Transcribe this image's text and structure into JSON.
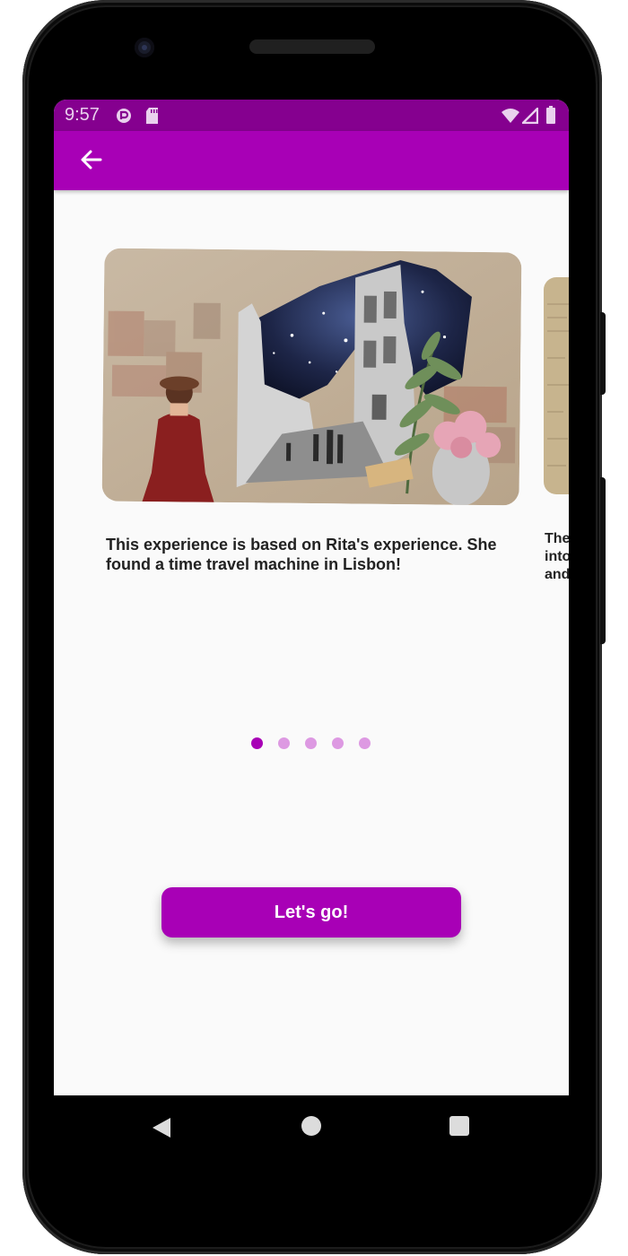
{
  "status_bar": {
    "time": "9:57",
    "icons": [
      "app-notification-icon",
      "sd-card-icon",
      "wifi-icon",
      "signal-icon",
      "battery-icon"
    ]
  },
  "app_bar": {
    "back_icon": "arrow-left-icon"
  },
  "carousel": {
    "slides": [
      {
        "caption": "This experience is based on Rita's experience. She found a time travel machine in Lisbon!"
      },
      {
        "caption": "The\ninto\nand"
      }
    ],
    "page_count": 5,
    "active_index": 0
  },
  "primary_button": {
    "label": "Let's go!"
  },
  "colors": {
    "status_bar": "#85008f",
    "app_bar": "#a800b6",
    "accent": "#a800b6",
    "dot_inactive": "#dd99e2",
    "background": "#fafafa"
  }
}
